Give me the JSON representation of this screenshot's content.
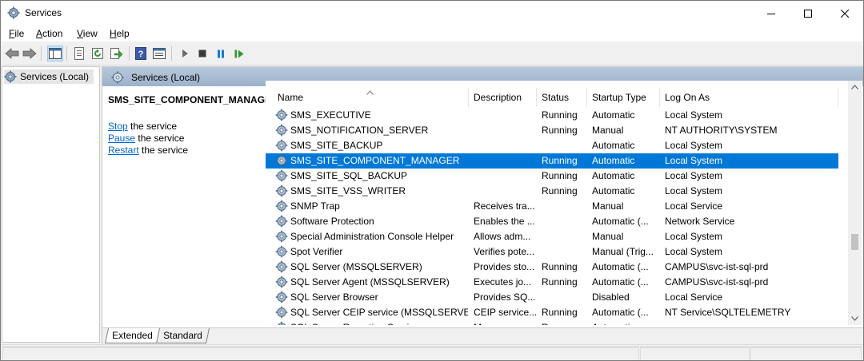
{
  "window": {
    "title": "Services",
    "icon": "services-gear-icon",
    "controls": [
      "minimize-icon",
      "maximize-icon",
      "close-icon"
    ]
  },
  "menu": {
    "file": {
      "hotkey": "F",
      "rest": "ile"
    },
    "action": {
      "hotkey": "A",
      "rest": "ction"
    },
    "view": {
      "hotkey": "V",
      "rest": "iew"
    },
    "help": {
      "hotkey": "H",
      "rest": "elp"
    }
  },
  "toolbar": {
    "buttons": [
      "back-arrow-icon",
      "forward-arrow-icon",
      "show-hide-tree-icon",
      "properties-icon",
      "refresh-icon",
      "export-list-icon",
      "help-icon",
      "action-pane-icon",
      "start-service-icon",
      "stop-service-icon",
      "pause-service-icon",
      "resume-service-icon"
    ]
  },
  "tree": {
    "selected": "Services (Local)"
  },
  "pane_header": "Services (Local)",
  "detail": {
    "service_name": "SMS_SITE_COMPONENT_MANAGER",
    "actions": [
      {
        "link": "Stop",
        "rest": " the service"
      },
      {
        "link": "Pause",
        "rest": " the service"
      },
      {
        "link": "Restart",
        "rest": " the service"
      }
    ]
  },
  "columns": [
    "Name",
    "Description",
    "Status",
    "Startup Type",
    "Log On As"
  ],
  "sort_indicator": "^",
  "services": [
    {
      "name": "SMS_EXECUTIVE",
      "description": "",
      "status": "Running",
      "startup": "Automatic",
      "logon": "Local System"
    },
    {
      "name": "SMS_NOTIFICATION_SERVER",
      "description": "",
      "status": "Running",
      "startup": "Manual",
      "logon": "NT AUTHORITY\\SYSTEM"
    },
    {
      "name": "SMS_SITE_BACKUP",
      "description": "",
      "status": "",
      "startup": "Automatic",
      "logon": "Local System"
    },
    {
      "name": "SMS_SITE_COMPONENT_MANAGER",
      "description": "",
      "status": "Running",
      "startup": "Automatic",
      "logon": "Local System",
      "selected": true
    },
    {
      "name": "SMS_SITE_SQL_BACKUP",
      "description": "",
      "status": "Running",
      "startup": "Automatic",
      "logon": "Local System"
    },
    {
      "name": "SMS_SITE_VSS_WRITER",
      "description": "",
      "status": "Running",
      "startup": "Automatic",
      "logon": "Local System"
    },
    {
      "name": "SNMP Trap",
      "description": "Receives tra...",
      "status": "",
      "startup": "Manual",
      "logon": "Local Service"
    },
    {
      "name": "Software Protection",
      "description": "Enables the ...",
      "status": "",
      "startup": "Automatic (...",
      "logon": "Network Service"
    },
    {
      "name": "Special Administration Console Helper",
      "description": "Allows adm...",
      "status": "",
      "startup": "Manual",
      "logon": "Local System"
    },
    {
      "name": "Spot Verifier",
      "description": "Verifies pote...",
      "status": "",
      "startup": "Manual (Trig...",
      "logon": "Local System"
    },
    {
      "name": "SQL Server (MSSQLSERVER)",
      "description": "Provides sto...",
      "status": "Running",
      "startup": "Automatic (...",
      "logon": "CAMPUS\\svc-ist-sql-prd"
    },
    {
      "name": "SQL Server Agent (MSSQLSERVER)",
      "description": "Executes jo...",
      "status": "Running",
      "startup": "Automatic (...",
      "logon": "CAMPUS\\svc-ist-sql-prd"
    },
    {
      "name": "SQL Server Browser",
      "description": "Provides SQ...",
      "status": "",
      "startup": "Disabled",
      "logon": "Local Service"
    },
    {
      "name": "SQL Server CEIP service (MSSQLSERVER)",
      "description": "CEIP service...",
      "status": "Running",
      "startup": "Automatic (...",
      "logon": "NT Service\\SQLTELEMETRY"
    },
    {
      "name": "SQL Server Reporting Services",
      "description": "M...",
      "status": "R...",
      "startup": "Automatic...",
      "logon": "..."
    }
  ],
  "tabs": {
    "extended": "Extended",
    "standard": "Standard"
  },
  "colors": {
    "selection": "#0078d7",
    "header_band": "#a6bad0",
    "link": "#0066cc"
  }
}
